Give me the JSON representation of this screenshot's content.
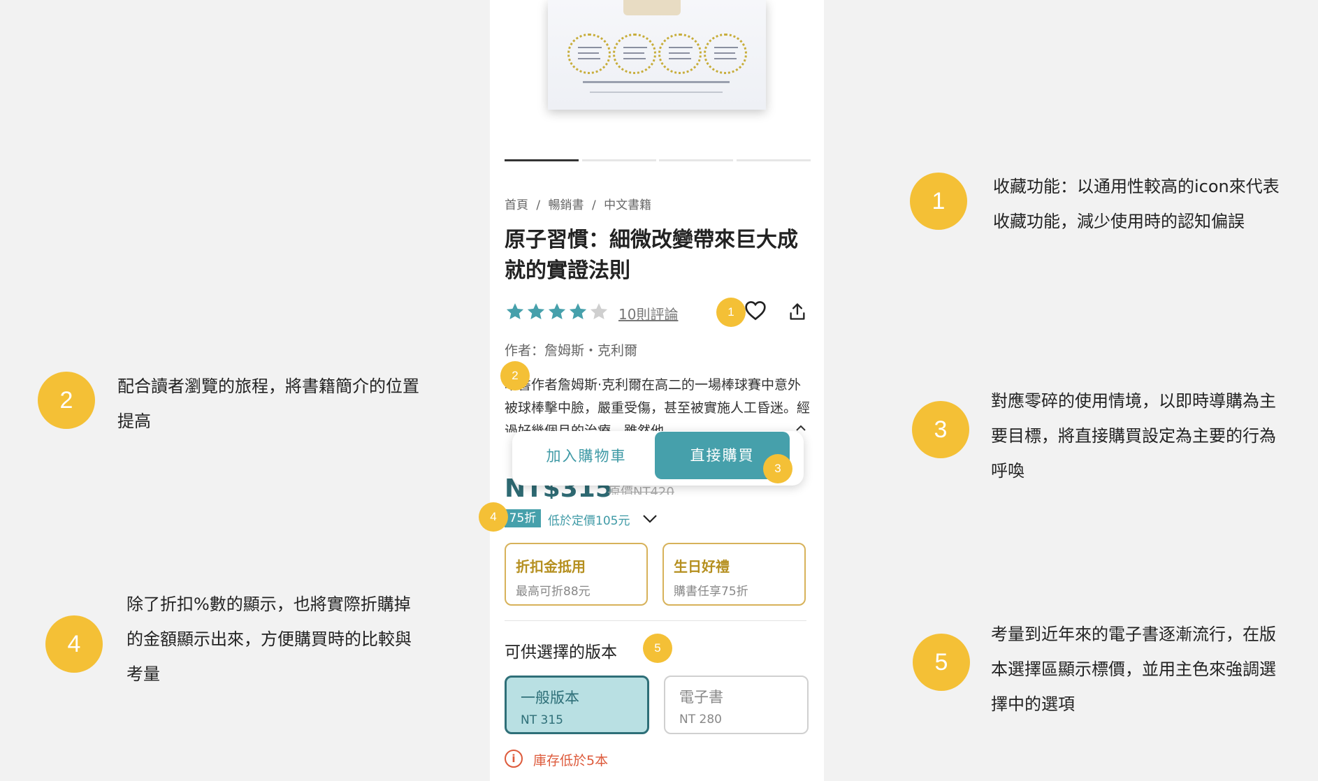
{
  "annotations": [
    {
      "number": "1",
      "text": "收藏功能：以通用性較高的icon來代表收藏功能，減少使用時的認知偏誤"
    },
    {
      "number": "2",
      "text": "配合讀者瀏覽的旅程，將書籍簡介的位置提高"
    },
    {
      "number": "3",
      "text": "對應零碎的使用情境，以即時導購為主要目標，將直接購買設定為主要的行為呼喚"
    },
    {
      "number": "4",
      "text": "除了折扣%數的顯示，也將實際折購掉的金額顯示出來，方便購買時的比較與考量"
    },
    {
      "number": "5",
      "text": "考量到近年來的電子書逐漸流行，在版本選擇區顯示標價，並用主色來強調選擇中的選項"
    }
  ],
  "product": {
    "breadcrumb": [
      "首頁",
      "/",
      "暢銷書",
      "/",
      "中文書籍"
    ],
    "title": "原子習慣：細微改變帶來巨大成就的實證法則",
    "rating": 4,
    "rating_max": 5,
    "reviews_label": "10則評論",
    "author": "作者：詹姆斯・克利爾",
    "description": "本書作者詹姆斯·克利爾在高二的一場棒球賽中意外被球棒擊中臉，嚴重受傷，甚至被實施人工昏迷。經過好幾個月的治療，雖然他",
    "cta": {
      "cart": "加入購物車",
      "buy": "直接購買"
    },
    "price": "NT$315",
    "original_price": "原價NT420",
    "discount_tag": "75折",
    "discount_text": "低於定價105元",
    "promos": [
      {
        "title": "折扣金抵用",
        "subtitle": "最高可折88元"
      },
      {
        "title": "生日好禮",
        "subtitle": "購書任享75折"
      }
    ],
    "versions_title": "可供選擇的版本",
    "versions": [
      {
        "name": "一般版本",
        "price": "NT 315",
        "selected": true
      },
      {
        "name": "電子書",
        "price": "NT 280",
        "selected": false
      }
    ],
    "stock_icon": "i",
    "stock_text": "庫存低於5本"
  },
  "colors": {
    "accent": "#46a0ab",
    "accent_dark": "#2e6f78",
    "highlight": "#f4c036",
    "promo_border": "#d7b25a",
    "warning": "#dd5a3b"
  },
  "icons": {
    "star": "star-icon",
    "favorite": "heart-icon",
    "share": "share-icon",
    "expand": "chevron-down-icon",
    "stock": "info-icon"
  }
}
